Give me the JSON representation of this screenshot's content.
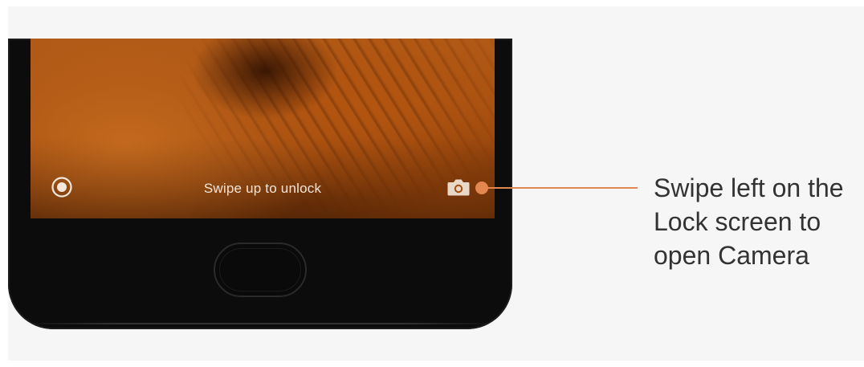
{
  "lock_screen": {
    "unlock_hint": "Swipe up to unlock",
    "left_shortcut_icon": "record-circle-icon",
    "right_shortcut_icon": "camera-icon"
  },
  "callout": {
    "text": "Swipe left on the Lock screen to open Camera",
    "color": "#e2874f"
  },
  "colors": {
    "phone_body": "#0c0c0c",
    "wallpaper_accent": "#b15a17",
    "panel_background": "#f6f6f6",
    "caption_text": "#333333"
  }
}
